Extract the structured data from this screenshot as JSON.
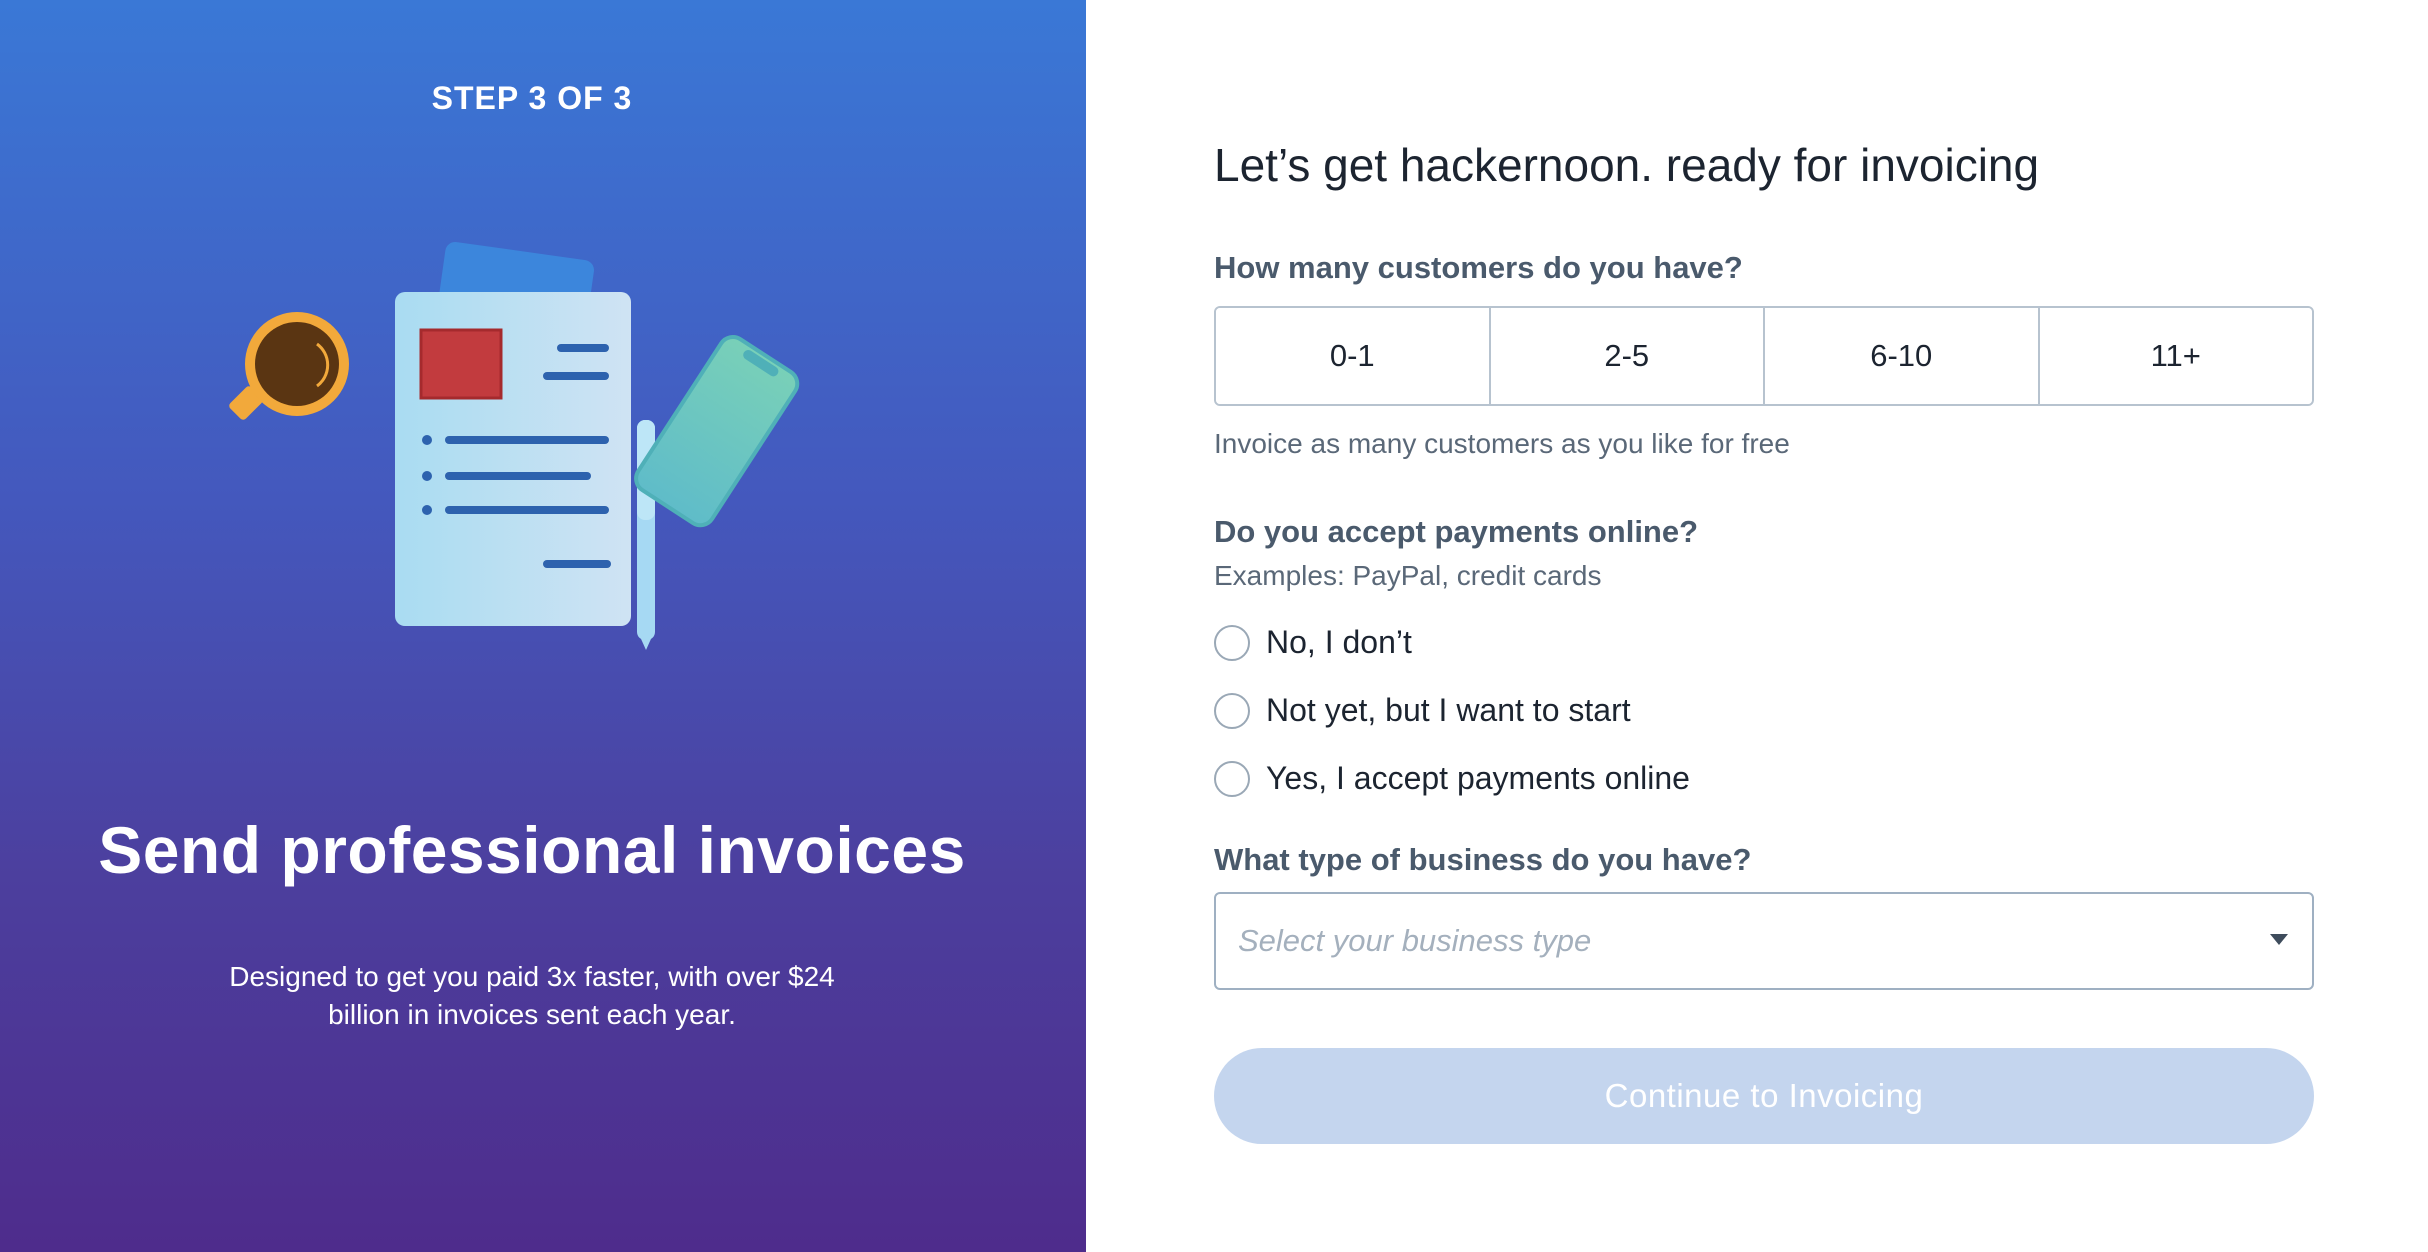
{
  "left": {
    "step": "STEP 3 OF 3",
    "title": "Send professional invoices",
    "description": "Designed to get you paid 3x faster, with over $24 billion in invoices sent each year."
  },
  "form": {
    "title": "Let’s get hackernoon. ready for invoicing",
    "customers": {
      "label": "How many customers do you have?",
      "options": [
        "0-1",
        "2-5",
        "6-10",
        "11+"
      ],
      "helper": "Invoice as many customers as you like for free"
    },
    "payments": {
      "label": "Do you accept payments online?",
      "sublabel": "Examples: PayPal, credit cards",
      "options": [
        "No, I don’t",
        "Not yet, but I want to start",
        "Yes, I accept payments online"
      ]
    },
    "business": {
      "label": "What type of business do you have?",
      "placeholder": "Select your business type"
    },
    "continue_label": "Continue to Invoicing"
  },
  "colors": {
    "gradient_top": "#3a78d6",
    "gradient_bottom": "#4e2c8c",
    "button_disabled": "#c4d5ee"
  },
  "icons": [
    "coffee-cup-icon",
    "invoice-document-icon",
    "pen-icon",
    "phone-icon",
    "dropdown-caret-icon"
  ]
}
